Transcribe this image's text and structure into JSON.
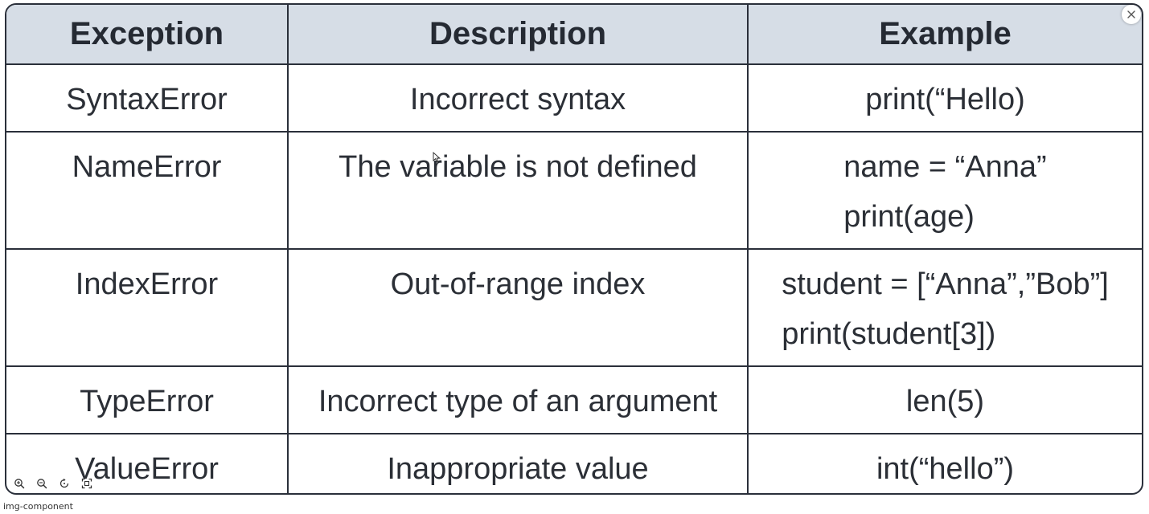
{
  "table": {
    "headers": [
      "Exception",
      "Description",
      "Example"
    ],
    "rows": [
      {
        "exception": "SyntaxError",
        "description": "Incorrect syntax",
        "example": [
          "print(“Hello)"
        ]
      },
      {
        "exception": "NameError",
        "description": "The variable is not defined",
        "example": [
          "name = “Anna”",
          "print(age)"
        ]
      },
      {
        "exception": "IndexError",
        "description": "Out-of-range index",
        "example": [
          "student = [“Anna”,”Bob”]",
          "print(student[3])"
        ]
      },
      {
        "exception": "TypeError",
        "description": "Incorrect type of an argument",
        "example": [
          "len(5)"
        ]
      },
      {
        "exception": "ValueError",
        "description": "Inappropriate value",
        "example": [
          "int(“hello”)"
        ]
      }
    ]
  },
  "viewer": {
    "component_label": "img-component",
    "icons": [
      "close-icon",
      "zoom-in-icon",
      "zoom-out-icon",
      "rotate-icon",
      "fit-screen-icon"
    ]
  },
  "colors": {
    "header_bg": "#d6dde6",
    "border": "#2a2f3a",
    "text": "#2b2f36"
  }
}
